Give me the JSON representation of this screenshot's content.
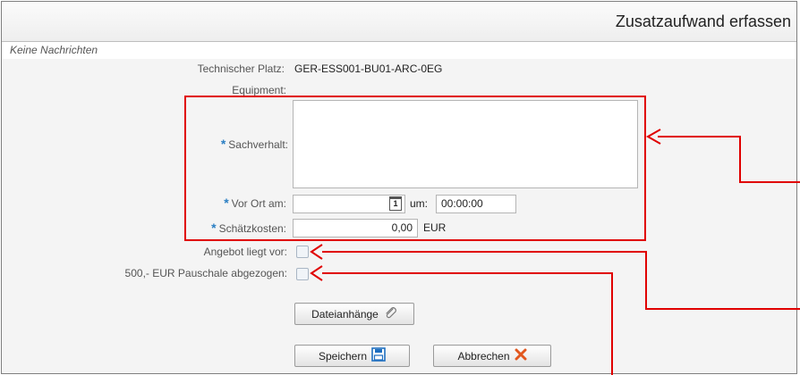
{
  "window": {
    "title": "Zusatzaufwand erfassen"
  },
  "messages": {
    "text": "Keine Nachrichten"
  },
  "form": {
    "technischer_platz": {
      "label": "Technischer Platz:",
      "value": "GER-ESS001-BU01-ARC-0EG"
    },
    "equipment": {
      "label": "Equipment:",
      "value": ""
    },
    "sachverhalt": {
      "required_mark": "*",
      "label": "Sachverhalt:",
      "value": ""
    },
    "vor_ort_am": {
      "required_mark": "*",
      "label": "Vor Ort am:",
      "date_value": "",
      "calendar_glyph": "1",
      "time_label": "um:",
      "time_value": "00:00:00"
    },
    "schaetzkosten": {
      "required_mark": "*",
      "label": "Schätzkosten:",
      "value": "0,00",
      "currency": "EUR"
    },
    "angebot": {
      "label": "Angebot liegt vor:",
      "checked": false
    },
    "pauschale": {
      "label": "500,- EUR Pauschale abgezogen:",
      "checked": false
    }
  },
  "buttons": {
    "attachments": "Dateianhänge",
    "save": "Speichern",
    "cancel": "Abbrechen"
  },
  "icons": {
    "paperclip": "paperclip-icon",
    "save": "floppy-disk-icon",
    "cancel": "red-x-icon",
    "calendar": "calendar-icon"
  },
  "colors": {
    "annotation": "#e00000",
    "required": "#2b7fc3",
    "save_icon": "#1e6fc0",
    "cancel_icon": "#e2571e"
  }
}
